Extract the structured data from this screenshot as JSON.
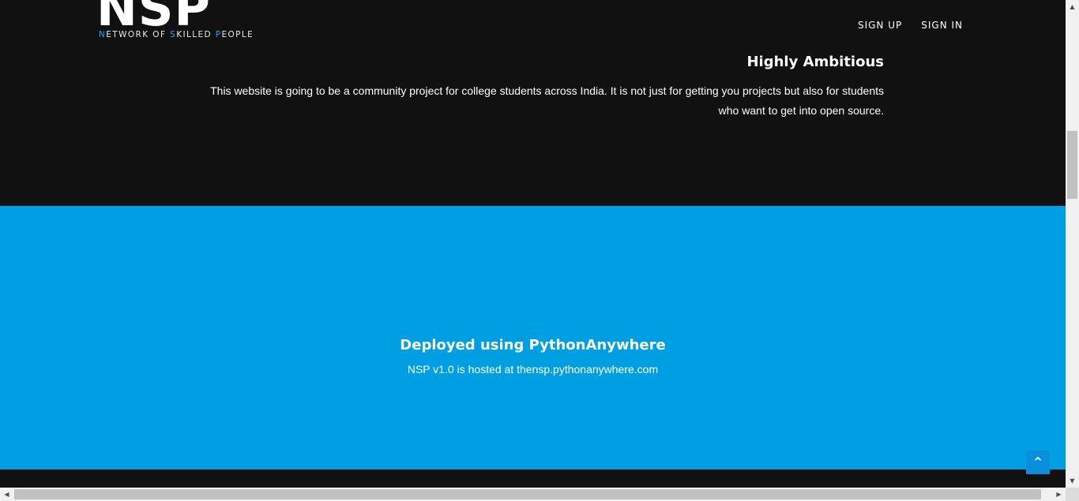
{
  "header": {
    "logo_text": "NSP",
    "tagline_parts": [
      {
        "text": "N",
        "highlight": true
      },
      {
        "text": "ETWORK OF ",
        "highlight": false
      },
      {
        "text": "S",
        "highlight": true
      },
      {
        "text": "KILLED ",
        "highlight": false
      },
      {
        "text": "P",
        "highlight": true
      },
      {
        "text": "EOPLE",
        "highlight": false
      }
    ],
    "nav": {
      "sign_up": "SIGN UP",
      "sign_in": "SIGN IN"
    }
  },
  "feature": {
    "title": "Highly Ambitious",
    "text": "This website is going to be a community project for college students across India. It is not just for getting you projects but also for students who want to get into open source."
  },
  "deploy": {
    "title": "Deployed using PythonAnywhere",
    "text": "NSP v1.0 is hosted at thensp.pythonanywhere.com"
  },
  "back_to_top": {
    "label": "^"
  },
  "colors": {
    "dark_bg": "#111111",
    "accent_blue": "#009fe3",
    "logo_highlight": "#1da1f2",
    "button_blue": "#0a8fdc"
  },
  "icons": {
    "scroll_up": "triangle-up-icon",
    "scroll_down": "triangle-down-icon",
    "scroll_left": "triangle-left-icon",
    "scroll_right": "triangle-right-icon"
  }
}
